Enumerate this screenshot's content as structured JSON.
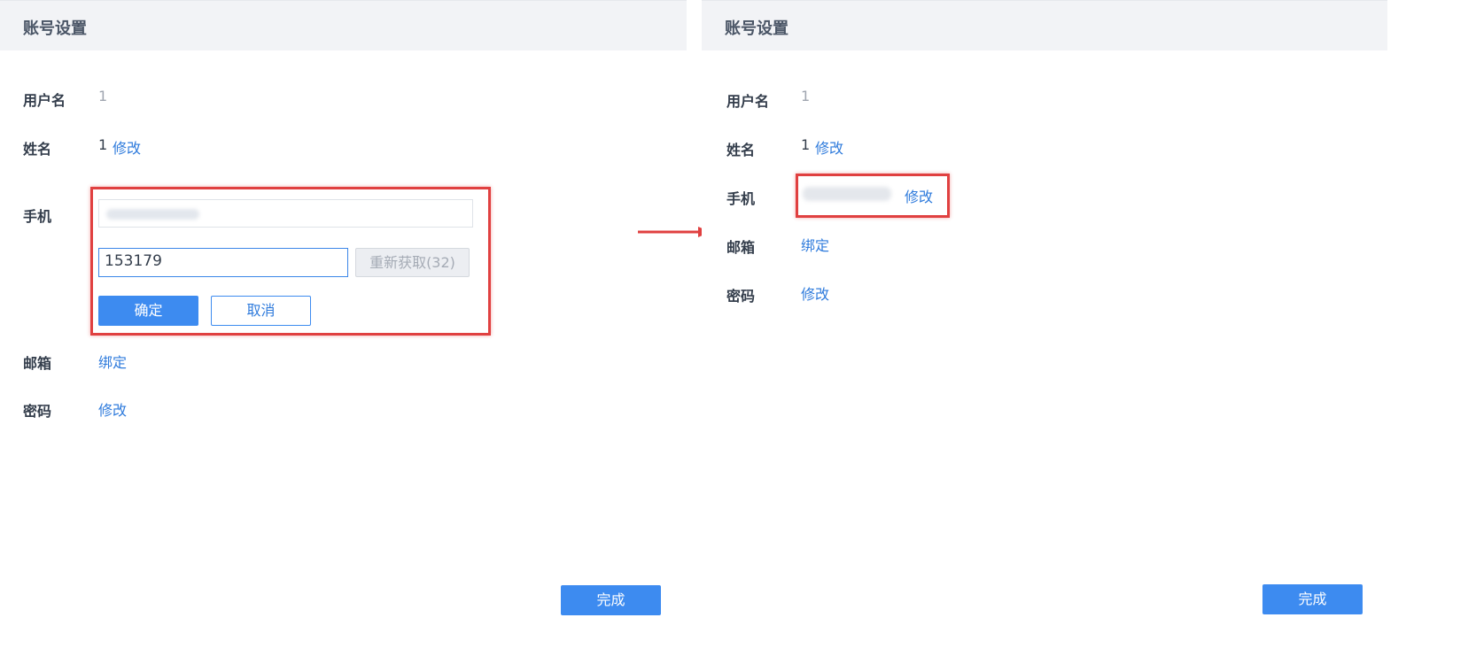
{
  "left_panel": {
    "title": "账号设置",
    "rows": {
      "username": {
        "label": "用户名",
        "value": "1"
      },
      "name": {
        "label": "姓名",
        "value": "1",
        "action": "修改"
      },
      "phone": {
        "label": "手机",
        "code_value": "153179",
        "resend_label": "重新获取(32)",
        "confirm_label": "确定",
        "cancel_label": "取消"
      },
      "email": {
        "label": "邮箱",
        "action": "绑定"
      },
      "password": {
        "label": "密码",
        "action": "修改"
      }
    },
    "done_label": "完成"
  },
  "right_panel": {
    "title": "账号设置",
    "rows": {
      "username": {
        "label": "用户名",
        "value": "1"
      },
      "name": {
        "label": "姓名",
        "value": "1",
        "action": "修改"
      },
      "phone": {
        "label": "手机",
        "action": "修改"
      },
      "email": {
        "label": "邮箱",
        "action": "绑定"
      },
      "password": {
        "label": "密码",
        "action": "修改"
      }
    },
    "done_label": "完成"
  },
  "colors": {
    "accent": "#3d8bf0",
    "link": "#2f7bdc",
    "highlight": "#e04040",
    "header_bg": "#f2f3f6"
  }
}
